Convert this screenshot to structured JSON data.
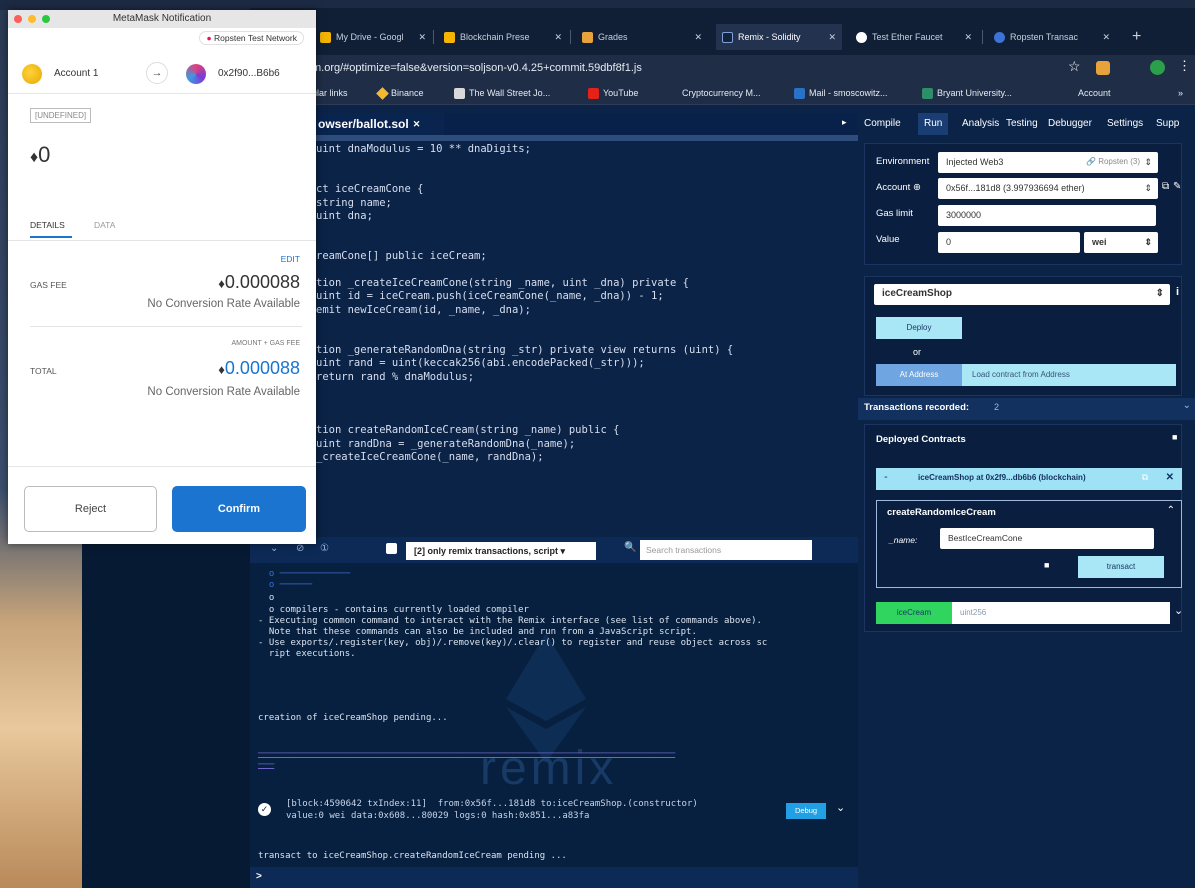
{
  "metamask": {
    "window_title": "MetaMask Notification",
    "network": "Ropsten Test Network",
    "from_account": "Account 1",
    "to_address": "0x2f90...B6b6",
    "contract_badge": "[UNDEFINED]",
    "amount": "0",
    "tabs": [
      "DETAILS",
      "DATA"
    ],
    "edit": "EDIT",
    "gas_fee_label": "GAS FEE",
    "gas_fee_value": "0.000088",
    "no_conversion": "No Conversion Rate Available",
    "amount_gas_label": "AMOUNT + GAS FEE",
    "total_label": "TOTAL",
    "total_value": "0.000088",
    "reject": "Reject",
    "confirm": "Confirm"
  },
  "browser": {
    "tabs": [
      {
        "label": "My Drive - Googl",
        "fav_color": "#f4b400"
      },
      {
        "label": "Blockchain Prese",
        "fav_color": "#f4b400"
      },
      {
        "label": "Grades",
        "fav_color": "#e8a23b"
      },
      {
        "label": "Remix - Solidity",
        "fav_color": "#13233e"
      },
      {
        "label": "Test Ether Faucet",
        "fav_color": "#ffffff"
      },
      {
        "label": "Ropsten Transac",
        "fav_color": "#3b74d6"
      }
    ],
    "url": "m.org/#optimize=false&version=soljson-v0.4.25+commit.59dbf8f1.js",
    "bookmarks": [
      "ular links",
      "Binance",
      "The Wall Street Jo...",
      "YouTube",
      "Cryptocurrency M...",
      "Mail - smoscowitz...",
      "Bryant University...",
      "Account"
    ]
  },
  "editor": {
    "file_tab": "owser/ballot.sol",
    "code_lines": [
      "uint dnaModulus = 10 ** dnaDigits;",
      "",
      "",
      "ct iceCreamCone {",
      "string name;",
      "uint dna;",
      "",
      "",
      "reamCone[] public iceCream;",
      "",
      "tion _createIceCreamCone(string _name, uint _dna) private {",
      "uint id = iceCream.push(iceCreamCone(_name, _dna)) - 1;",
      "emit newIceCream(id, _name, _dna);",
      "",
      "",
      "tion _generateRandomDna(string _str) private view returns (uint) {",
      "uint rand = uint(keccak256(abi.encodePacked(_str)));",
      "return rand % dnaModulus;",
      "",
      "",
      "",
      "tion createRandomIceCream(string _name) public {",
      "uint randDna = _generateRandomDna(_name);",
      "_createIceCreamCone(_name, randDna);"
    ]
  },
  "panel": {
    "tabs": [
      "Compile",
      "Run",
      "Analysis",
      "Testing",
      "Debugger",
      "Settings",
      "Supp"
    ],
    "environment_label": "Environment",
    "environment_value": "Injected Web3",
    "network_hint": "Ropsten (3)",
    "account_label": "Account",
    "account_value": "0x56f...181d8 (3.997936694 ether)",
    "gas_limit_label": "Gas limit",
    "gas_limit_value": "3000000",
    "value_label": "Value",
    "value_value": "0",
    "value_unit": "wei",
    "contract_select": "iceCreamShop",
    "deploy": "Deploy",
    "or": "or",
    "at_address": "At Address",
    "load_placeholder": "Load contract from Address",
    "transactions_recorded": "Transactions recorded:",
    "transactions_count": "2",
    "deployed_contracts": "Deployed Contracts",
    "instance_label": "iceCreamShop at 0x2f9...db6b6 (blockchain)",
    "function_name": "createRandomIceCream",
    "param_label": "_name:",
    "param_value": "BestIceCreamCone",
    "transact": "transact",
    "icecream_button": "iceCream",
    "icecream_placeholder": "uint256"
  },
  "terminal": {
    "filter": "[2] only remix transactions, script",
    "search_placeholder": "Search transactions",
    "lines": [
      "  o compilers - contains currently loaded compiler",
      "- Executing common command to interact with the Remix interface (see list of commands above).",
      "  Note that these commands can also be included and run from a JavaScript script.",
      "- Use exports/.register(key, obj)/.remove(key)/.clear() to register and reuse object across sc",
      "  ript executions."
    ],
    "pending_creation": "creation of iceCreamShop pending...",
    "tx_line1": "[block:4590642 txIndex:11]  from:0x56f...181d8 to:iceCreamShop.(constructor)",
    "tx_line2": "value:0 wei data:0x608...80029 logs:0 hash:0x851...a83fa",
    "debug": "Debug",
    "pending_transact": "transact to iceCreamShop.createRandomIceCream pending ...",
    "prompt": ">",
    "watermark": "remix"
  },
  "colors": {
    "confirm_blue": "#1b74d0",
    "remix_green": "#2fd55f",
    "remix_cyan": "#9fe2f6"
  }
}
